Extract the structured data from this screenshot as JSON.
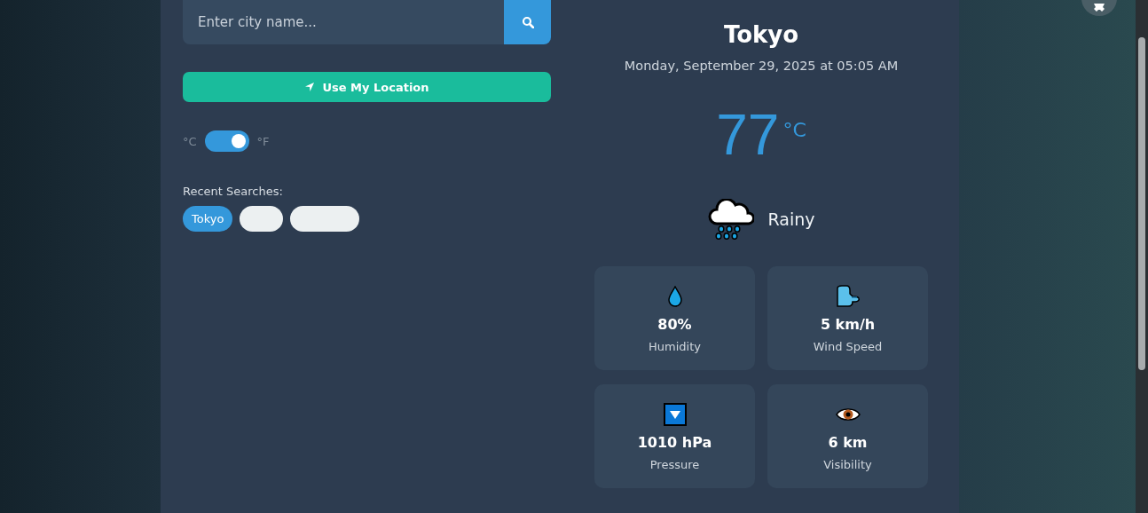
{
  "search": {
    "placeholder": "Enter city name..."
  },
  "location_button": {
    "label": "Use My Location"
  },
  "unit_toggle": {
    "celsius_label": "°C",
    "fahrenheit_label": "°F",
    "on": true
  },
  "recent_searches": {
    "title": "Recent Searches:",
    "items": [
      {
        "label": "Tokyo",
        "selected": true
      },
      {
        "selected": false
      },
      {
        "selected": false
      }
    ]
  },
  "weather": {
    "city": "Tokyo",
    "date": "Monday, September 29, 2025 at 05:05 AM",
    "temperature": "77",
    "unit": "°C",
    "condition": "Rainy"
  },
  "stats": [
    {
      "kind": "drop",
      "value": "80%",
      "label": "Humidity"
    },
    {
      "kind": "wind",
      "value": "5 km/h",
      "label": "Wind Speed"
    },
    {
      "kind": "pressure",
      "value": "1010 hPa",
      "label": "Pressure"
    },
    {
      "kind": "eye",
      "value": "6 km",
      "label": "Visibility"
    }
  ]
}
